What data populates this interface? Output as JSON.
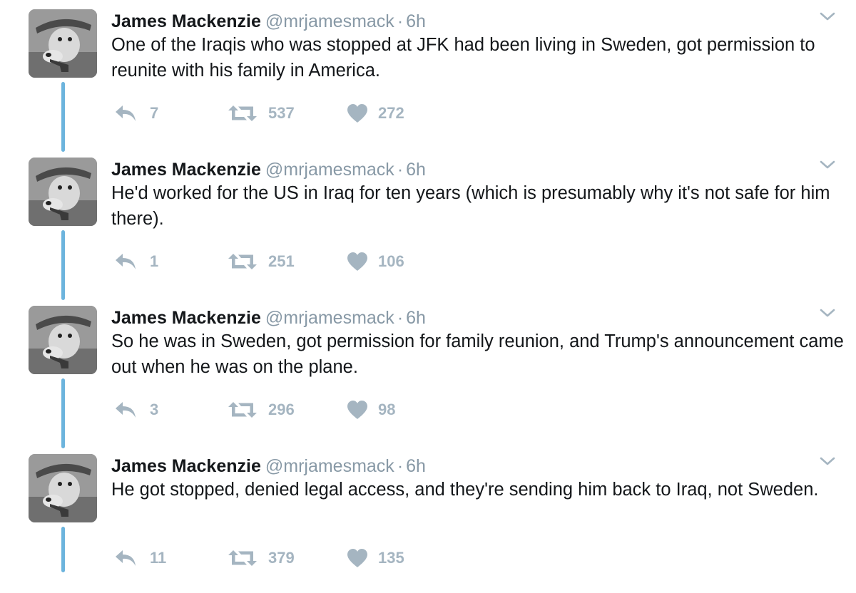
{
  "tweets": [
    {
      "name": "James Mackenzie",
      "handle": "@mrjamesmack",
      "separator": "·",
      "time": "6h",
      "text": "One of the Iraqis who was stopped at JFK had been living in Sweden, got permission to reunite with his family in America.",
      "replies": "7",
      "retweets": "537",
      "likes": "272"
    },
    {
      "name": "James Mackenzie",
      "handle": "@mrjamesmack",
      "separator": "·",
      "time": "6h",
      "text": "He'd worked for the US in Iraq for ten years (which is presumably why it's not safe for him there).",
      "replies": "1",
      "retweets": "251",
      "likes": "106"
    },
    {
      "name": "James Mackenzie",
      "handle": "@mrjamesmack",
      "separator": "·",
      "time": "6h",
      "text": "So he was in Sweden, got permission for family reunion, and Trump's announcement came out when he was on the plane.",
      "replies": "3",
      "retweets": "296",
      "likes": "98"
    },
    {
      "name": "James Mackenzie",
      "handle": "@mrjamesmack",
      "separator": "·",
      "time": "6h",
      "text": "He got stopped, denied legal access, and they're sending him back to Iraq, not Sweden.",
      "replies": "11",
      "retweets": "379",
      "likes": "135"
    }
  ],
  "colors": {
    "thread_line": "#6cb4dd",
    "meta_gray": "#8899a6",
    "action_gray": "#a5b5c1",
    "text": "#14171a"
  },
  "icons": {
    "reply": "reply-arrow-icon",
    "retweet": "retweet-icon",
    "like": "heart-icon",
    "menu": "chevron-down-icon"
  }
}
